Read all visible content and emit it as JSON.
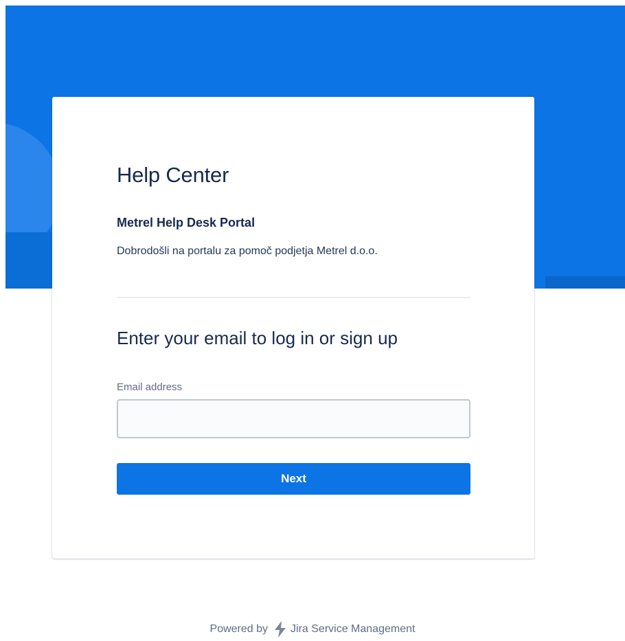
{
  "colors": {
    "brand_blue": "#0c74e4",
    "heading_text": "#172b4d",
    "muted_text": "#5e6c84"
  },
  "card": {
    "help_center_title": "Help Center",
    "portal_name": "Metrel Help Desk Portal",
    "portal_description": "Dobrodošli na portalu za pomoč podjetja Metrel d.o.o."
  },
  "login": {
    "heading": "Enter your email to log in or sign up",
    "email_label": "Email address",
    "email_value": "",
    "next_label": "Next"
  },
  "footer": {
    "powered_by": "Powered by",
    "product_name": "Jira Service Management",
    "icon": "jira-service-management-icon"
  }
}
